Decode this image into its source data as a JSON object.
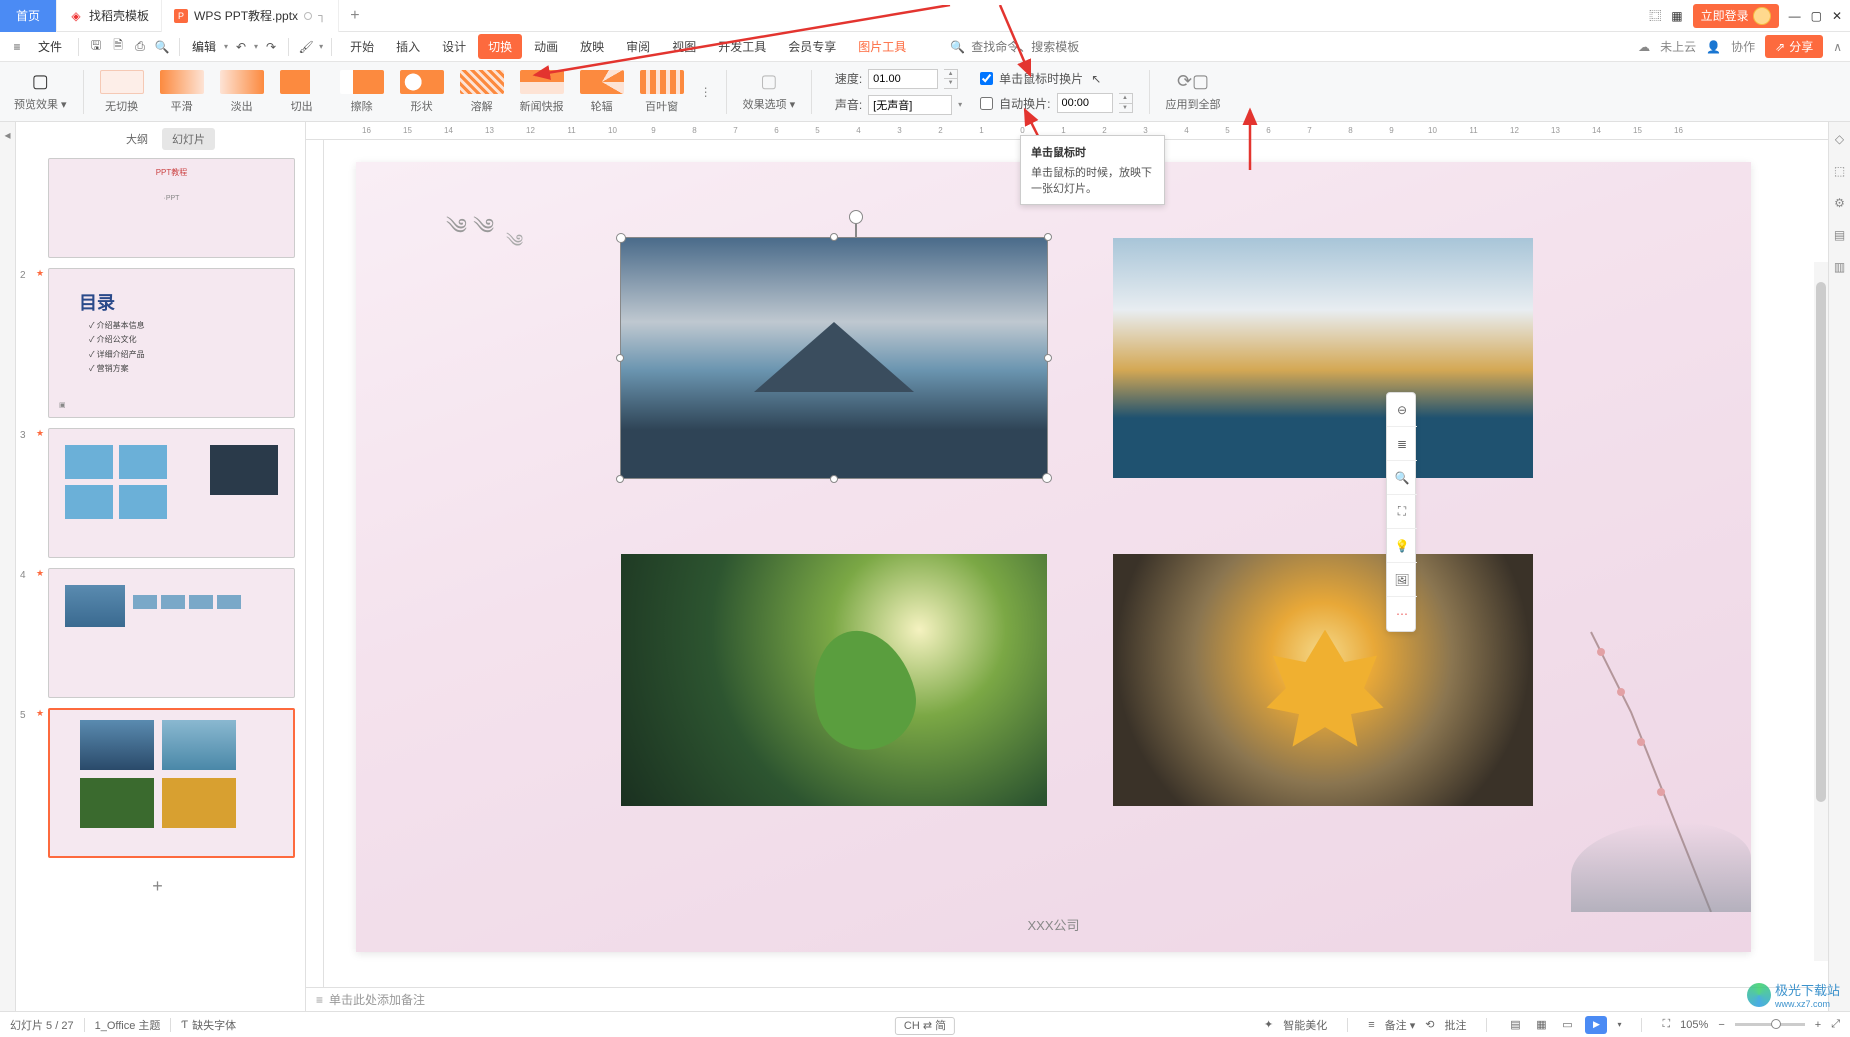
{
  "tabs": {
    "home": "首页",
    "template": "找稻壳模板",
    "file": "WPS PPT教程.pptx"
  },
  "titlebar_right": {
    "login": "立即登录"
  },
  "qat": {
    "file_menu": "文件",
    "edit": "编辑"
  },
  "menus": [
    "开始",
    "插入",
    "设计",
    "切换",
    "动画",
    "放映",
    "审阅",
    "视图",
    "开发工具",
    "会员专享",
    "图片工具"
  ],
  "active_menu_idx": 3,
  "search": {
    "cmd": "查找命令、搜索模板"
  },
  "menubar_right": {
    "cloud": "未上云",
    "coop": "协作",
    "share": "分享"
  },
  "ribbon": {
    "preview": "预览效果",
    "items": [
      "无切换",
      "平滑",
      "淡出",
      "切出",
      "擦除",
      "形状",
      "溶解",
      "新闻快报",
      "轮辐",
      "百叶窗"
    ],
    "effect_options": "效果选项",
    "speed_lbl": "速度:",
    "speed_val": "01.00",
    "sound_lbl": "声音:",
    "sound_val": "[无声音]",
    "click_lbl": "单击鼠标时换片",
    "auto_lbl": "自动换片:",
    "auto_val": "00:00",
    "apply_all": "应用到全部"
  },
  "tooltip": {
    "title": "单击鼠标时",
    "body": "单击鼠标的时候，放映下一张幻灯片。"
  },
  "thumb_tabs": {
    "outline": "大纲",
    "slides": "幻灯片"
  },
  "thumbs": {
    "t1a": "PPT教程",
    "t1b": "·PPT",
    "toc_title": "目录",
    "toc": [
      "✓ 介绍基本信息",
      "✓ 介绍公文化",
      "✓ 详细介绍产品",
      "✓ 营销方案"
    ]
  },
  "slide": {
    "company": "XXX公司"
  },
  "notes": "单击此处添加备注",
  "status": {
    "page": "幻灯片 5 / 27",
    "theme": "1_Office 主题",
    "font_missing": "缺失字体",
    "ime": "CH ⇄ 简",
    "beautify": "智能美化",
    "notes_btn": "备注",
    "comment": "批注",
    "zoom": "105%"
  },
  "watermark": {
    "l1": "极光下载站",
    "l2": "www.xz7.com"
  },
  "ruler": [
    "16",
    "15",
    "14",
    "13",
    "12",
    "11",
    "10",
    "9",
    "8",
    "7",
    "6",
    "5",
    "4",
    "3",
    "2",
    "1",
    "0",
    "1",
    "2",
    "3",
    "4",
    "5",
    "6",
    "7",
    "8",
    "9",
    "10",
    "11",
    "12",
    "13",
    "14",
    "15",
    "16"
  ]
}
